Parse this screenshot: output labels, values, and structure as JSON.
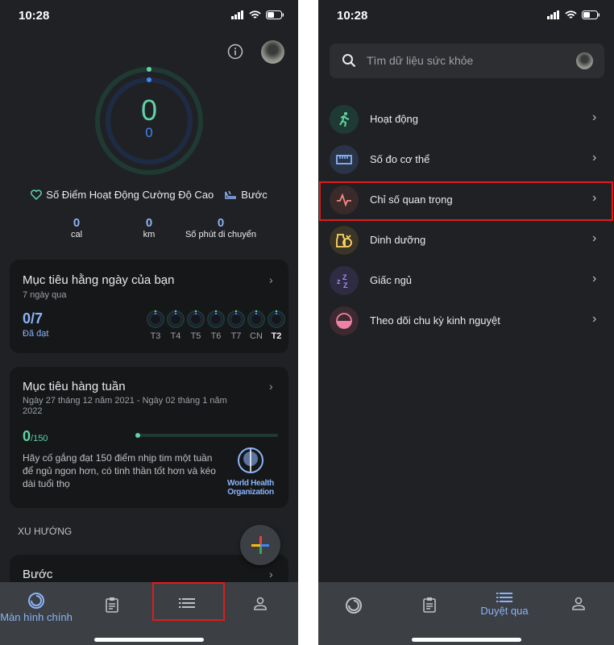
{
  "status": {
    "time": "10:28"
  },
  "home": {
    "ring": {
      "heart_points": "0",
      "steps": "0",
      "accent_green": "#5fd3a5",
      "accent_blue": "#4285f4"
    },
    "legend": {
      "heart_label": "Số Điểm Hoạt Động Cường Độ Cao",
      "steps_label": "Bước"
    },
    "stats": [
      {
        "value": "0",
        "unit": "cal"
      },
      {
        "value": "0",
        "unit": "km"
      },
      {
        "value": "0",
        "unit": "Số phút di chuyển"
      }
    ],
    "daily_goal": {
      "title": "Mục tiêu hằng ngày của bạn",
      "subtitle": "7 ngày qua",
      "value": "0/7",
      "value_label": "Đã đạt",
      "days": [
        "T3",
        "T4",
        "T5",
        "T6",
        "T7",
        "CN",
        "T2"
      ]
    },
    "weekly_goal": {
      "title": "Mục tiêu hàng tuần",
      "date_range": "Ngày 27 tháng 12 năm 2021 - Ngày 02 tháng 1 năm 2022",
      "value": "0",
      "target": "/150",
      "progress_percent": 0,
      "description": "Hãy cố gắng đạt 150 điểm nhịp tim một tuần để ngủ ngon hơn, có tinh thần tốt hơn và kéo dài tuổi thọ",
      "who_logo": "World Health Organization"
    },
    "trends_header": "XU HƯỚNG",
    "trend_card": {
      "title": "Bước"
    },
    "fab": {
      "icon": "plus-icon"
    },
    "nav": [
      {
        "label": "Màn hình chính",
        "icon": "ring-icon",
        "active": true
      },
      {
        "label": "",
        "icon": "journal-icon"
      },
      {
        "label": "",
        "icon": "list-icon"
      },
      {
        "label": "",
        "icon": "profile-icon"
      }
    ]
  },
  "browse": {
    "search_placeholder": "Tìm dữ liệu sức khỏe",
    "items": [
      {
        "label": "Hoạt động",
        "icon": "running-icon",
        "color": "#5fd3a5"
      },
      {
        "label": "Số đo cơ thể",
        "icon": "ruler-icon",
        "color": "#8ab4f8"
      },
      {
        "label": "Chỉ số quan trọng",
        "icon": "vitals-icon",
        "color": "#f28b82"
      },
      {
        "label": "Dinh dưỡng",
        "icon": "nutrition-icon",
        "color": "#fdd663"
      },
      {
        "label": "Giấc ngủ",
        "icon": "sleep-icon",
        "color": "#a78bfa"
      },
      {
        "label": "Theo dõi chu kỳ kinh nguyệt",
        "icon": "cycle-icon",
        "color": "#ee82a5"
      }
    ],
    "nav": [
      {
        "label": "",
        "icon": "ring-icon"
      },
      {
        "label": "",
        "icon": "journal-icon"
      },
      {
        "label": "Duyệt qua",
        "icon": "list-icon",
        "active": true
      },
      {
        "label": "",
        "icon": "profile-icon"
      }
    ]
  }
}
